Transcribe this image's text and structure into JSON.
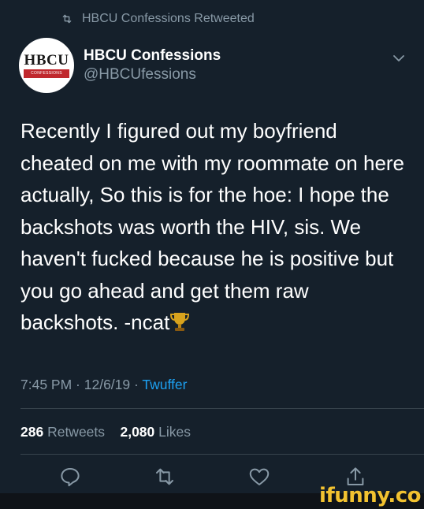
{
  "retweet_header": {
    "icon": "retweet-icon",
    "text": "HBCU Confessions Retweeted"
  },
  "author": {
    "avatar_logo_text": "HBCU",
    "avatar_logo_subtext": "CONFESSIONS",
    "name": "HBCU Confessions",
    "handle": "@HBCUfessions"
  },
  "tweet": {
    "text": "Recently I figured out my boyfriend cheated on me with my roommate on here actually, So this is for the hoe: I hope the backshots was worth the HIV, sis. We haven't fucked because he is positive but you go ahead and get them raw backshots. -ncat",
    "emoji": "trophy-icon"
  },
  "meta": {
    "time": "7:45 PM",
    "date": "12/6/19",
    "separator": " · ",
    "source": "Twuffer"
  },
  "stats": {
    "retweets_count": "286",
    "retweets_label": "Retweets",
    "likes_count": "2,080",
    "likes_label": "Likes"
  },
  "actions": [
    "reply-icon",
    "retweet-icon",
    "like-icon",
    "share-icon"
  ],
  "watermark": "ifunny.co",
  "colors": {
    "background": "#15202b",
    "secondary_text": "#8899a6",
    "link": "#1da1f2",
    "divider": "#38444d",
    "watermark": "#f2c230"
  }
}
